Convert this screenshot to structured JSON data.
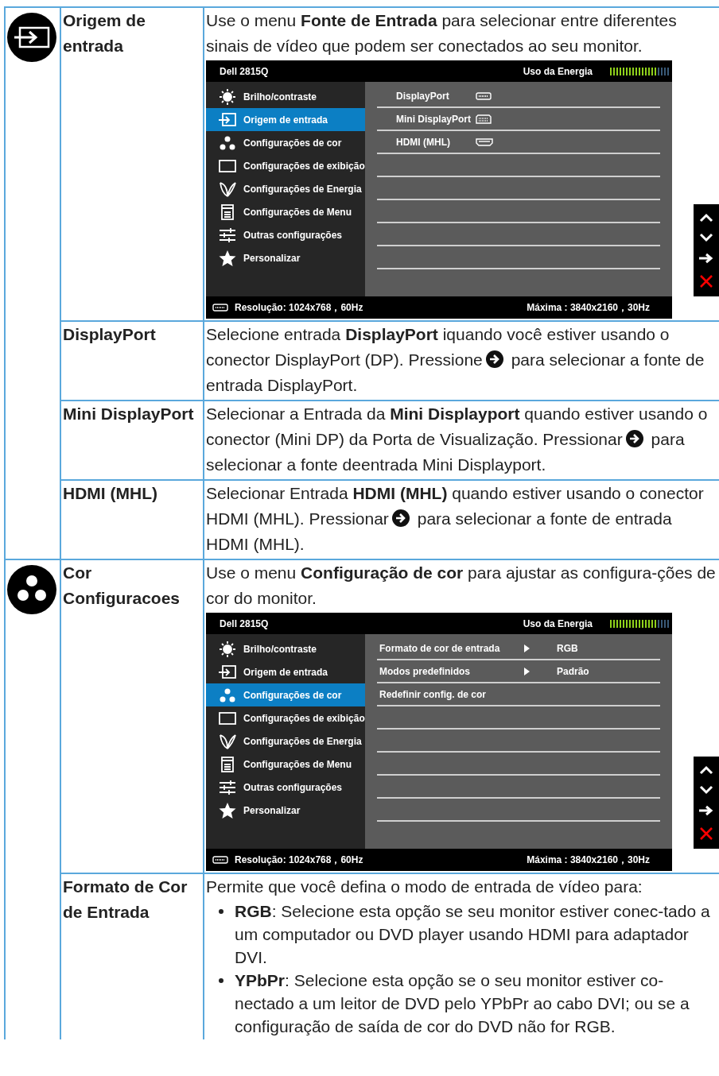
{
  "sections": [
    {
      "rows": [
        {
          "label": "Origem de entrada",
          "content": [
            {
              "kind": "text",
              "parts": [
                "Use o menu **Fonte de Entrada** para selecionar entre diferentes sinais de vídeo que podem ser conectados ao seu monitor."
              ]
            },
            {
              "kind": "osd",
              "model": "Dell 2815Q",
              "energy_label": "Uso da Energia",
              "energy": {
                "level": 0.79
              },
              "menu": [
                {
                  "label": "Brilho/contraste",
                  "selected": false
                },
                {
                  "label": "Origem de entrada",
                  "selected": true
                },
                {
                  "label": "Configurações de cor",
                  "selected": false
                },
                {
                  "label": "Configurações de exibição",
                  "selected": false
                },
                {
                  "label": "Configurações de Energia",
                  "selected": false
                },
                {
                  "label": "Configurações de Menu",
                  "selected": false
                },
                {
                  "label": "Outras configurações",
                  "selected": false
                },
                {
                  "label": "Personalizar",
                  "selected": false
                }
              ],
              "options": [
                {
                  "kind": "port",
                  "label": "DisplayPort"
                },
                {
                  "kind": "port",
                  "label": "Mini DisplayPort"
                },
                {
                  "kind": "port",
                  "label": "HDMI (MHL)"
                }
              ],
              "resolution": "Resolução: 1024x768，60Hz",
              "maximum": "Máxima : 3840x2160，30Hz"
            }
          ]
        },
        {
          "label": "DisplayPort",
          "content": [
            {
              "kind": "text",
              "parts": [
                "Selecione entrada **DisplayPort** iquando você estiver usando o conector DisplayPort (DP). Pressione",
                "para selecionar a fonte de entrada DisplayPort."
              ]
            }
          ]
        },
        {
          "label": "Mini DisplayPort",
          "content": [
            {
              "kind": "text",
              "parts": [
                "Selecionar a Entrada da **Mini Displayport** quando estiver usando o conector (Mini DP) da Porta de Visualização. Pressionar",
                "para selecionar a fonte deentrada Mini Displayport."
              ]
            }
          ]
        },
        {
          "label": "HDMI (MHL)",
          "content": [
            {
              "kind": "text",
              "parts": [
                "Selecionar Entrada **HDMI (MHL)** quando estiver usando o conector HDMI (MHL). Pressionar",
                "para selecionar a fonte de entrada HDMI (MHL)."
              ]
            }
          ]
        }
      ]
    },
    {
      "rows": [
        {
          "label": "Cor Configuracoes",
          "content": [
            {
              "kind": "text",
              "parts": [
                "Use o menu **Configuração de cor** para ajustar as configura-ções de cor do monitor."
              ]
            },
            {
              "kind": "osd",
              "model": "Dell 2815Q",
              "energy_label": "Uso da Energia",
              "energy": {
                "level": 0.79
              },
              "menu": [
                {
                  "label": "Brilho/contraste",
                  "selected": false
                },
                {
                  "label": "Origem de entrada",
                  "selected": false
                },
                {
                  "label": "Configurações de cor",
                  "selected": true
                },
                {
                  "label": "Configurações de exibição",
                  "selected": false
                },
                {
                  "label": "Configurações de Energia",
                  "selected": false
                },
                {
                  "label": "Configurações de Menu",
                  "selected": false
                },
                {
                  "label": "Outras configurações",
                  "selected": false
                },
                {
                  "label": "Personalizar",
                  "selected": false
                }
              ],
              "options": [
                {
                  "kind": "submenu",
                  "label": "Formato de cor de entrada",
                  "value": "RGB"
                },
                {
                  "kind": "submenu",
                  "label": "Modos predefinidos",
                  "value": "Padrão"
                },
                {
                  "kind": "action",
                  "label": "Redefinir config. de cor"
                }
              ],
              "resolution": "Resolução: 1024x768，60Hz",
              "maximum": "Máxima : 3840x2160，30Hz"
            }
          ]
        },
        {
          "label": "Formato de Cor de Entrada",
          "content": [
            {
              "kind": "text",
              "parts": [
                "Permite que você defina o modo de entrada de vídeo para:"
              ]
            },
            {
              "kind": "bullets",
              "items": [
                "**RGB**: Selecione esta opção se seu monitor estiver conec-tado a um computador ou DVD player usando HDMI para adaptador DVI.",
                "**YPbPr**: Selecione esta opção se o seu monitor estiver co-nectado a um leitor de DVD pelo YPbPr ao cabo DVI; ou se a configuração de saída de cor do DVD não for RGB."
              ]
            }
          ]
        }
      ]
    }
  ]
}
